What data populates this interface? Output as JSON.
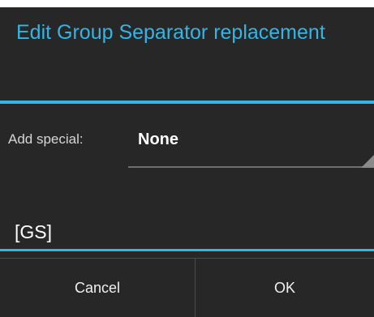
{
  "dialog": {
    "title": "Edit Group Separator replacement",
    "add_special_label": "Add special:",
    "add_special_value": "None",
    "input_value": "[GS]",
    "cancel_label": "Cancel",
    "ok_label": "OK"
  },
  "colors": {
    "accent": "#33b5e5",
    "background": "#272727",
    "text": "#ffffff"
  }
}
